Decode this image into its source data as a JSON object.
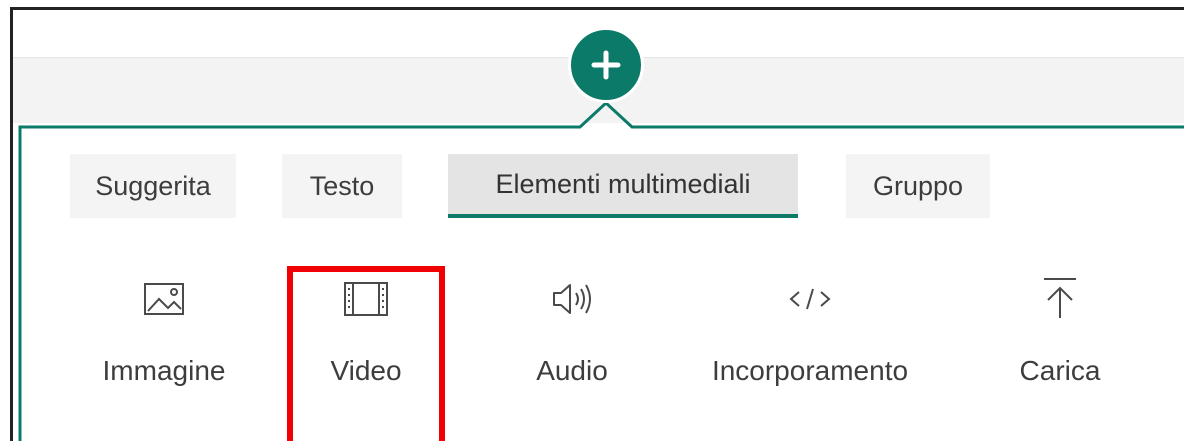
{
  "add_section": {
    "icon": "plus-icon",
    "color": "#0b7a69"
  },
  "tabs": [
    {
      "label": "Suggerita",
      "active": false
    },
    {
      "label": "Testo",
      "active": false
    },
    {
      "label": "Elementi multimediali",
      "active": true
    },
    {
      "label": "Gruppo",
      "active": false
    }
  ],
  "tools": [
    {
      "label": "Immagine",
      "icon": "image-icon"
    },
    {
      "label": "Video",
      "icon": "video-icon",
      "highlighted": true
    },
    {
      "label": "Audio",
      "icon": "audio-icon"
    },
    {
      "label": "Incorporamento",
      "icon": "code-icon"
    },
    {
      "label": "Carica",
      "icon": "upload-icon"
    }
  ],
  "colors": {
    "accent": "#0b7a69",
    "highlight": "#f00000"
  }
}
